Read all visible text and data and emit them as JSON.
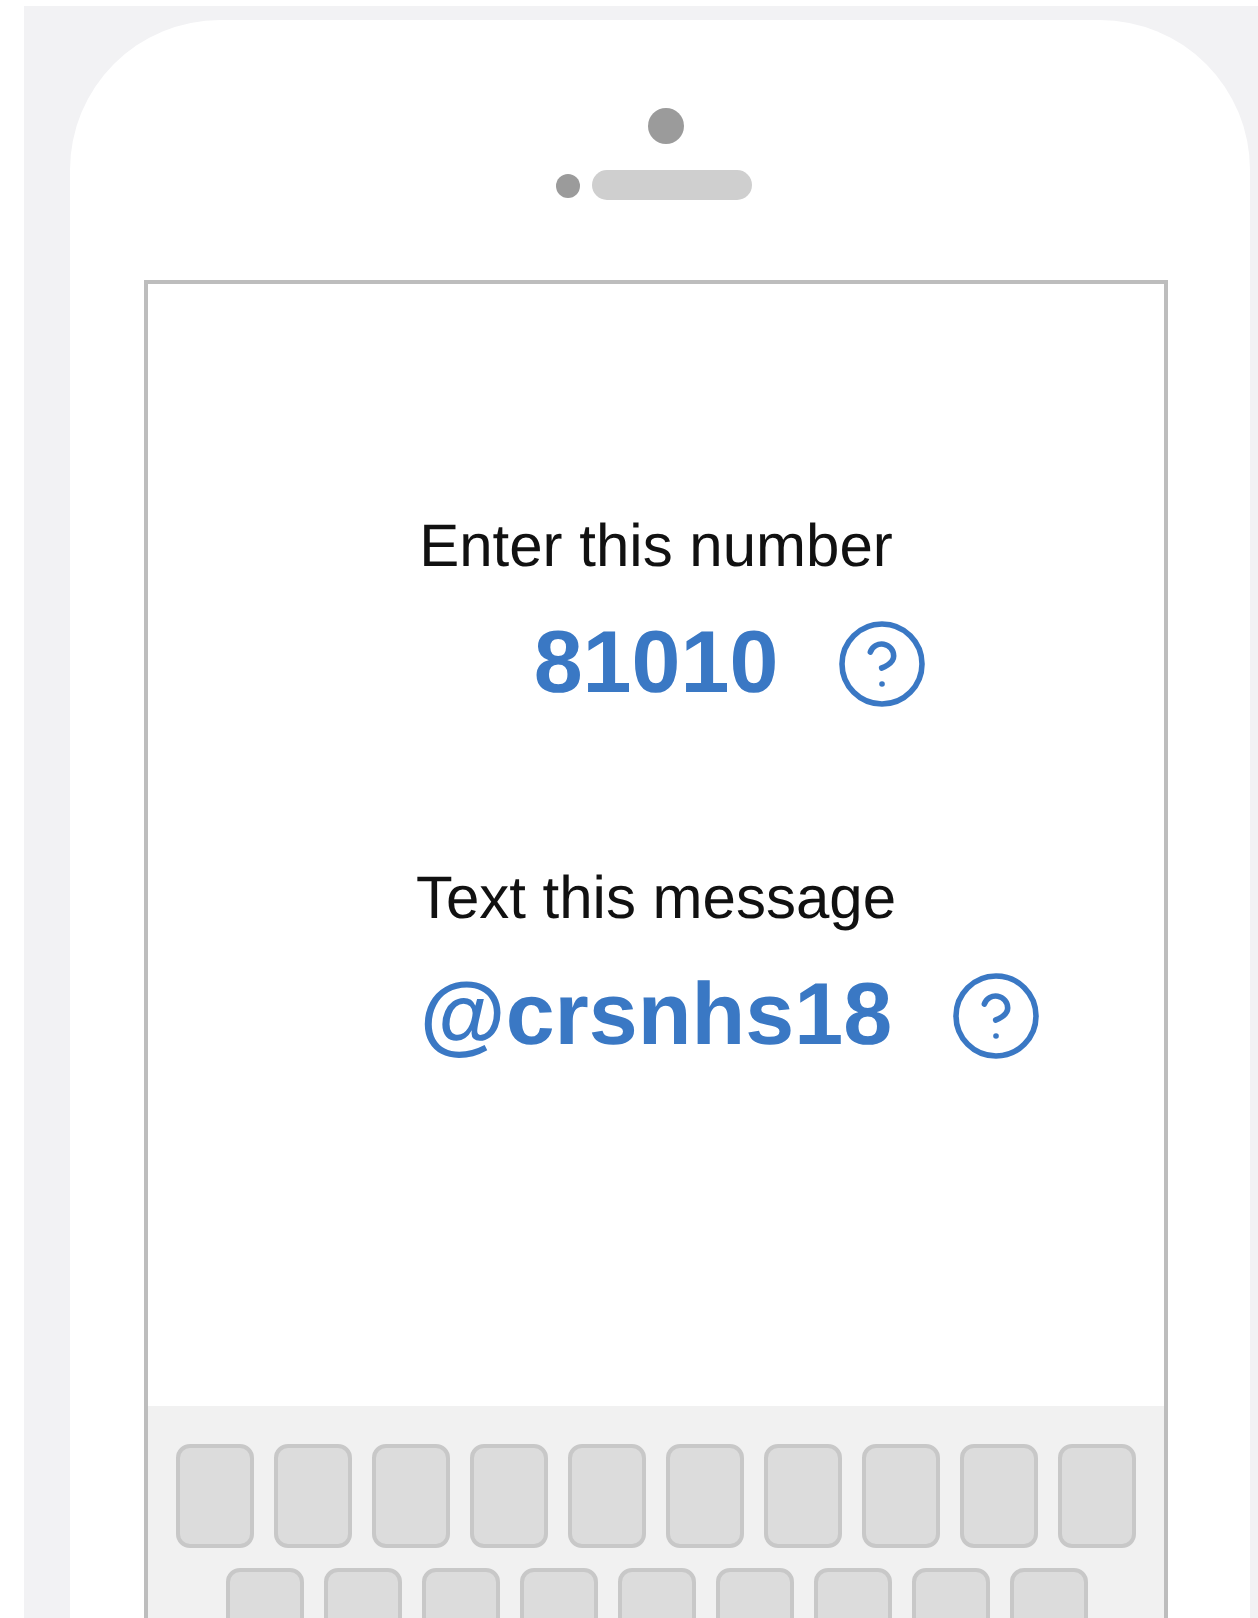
{
  "instructions": [
    {
      "label": "Enter this number",
      "value": "81010"
    },
    {
      "label": "Text this message",
      "value": "@crsnhs18"
    }
  ]
}
